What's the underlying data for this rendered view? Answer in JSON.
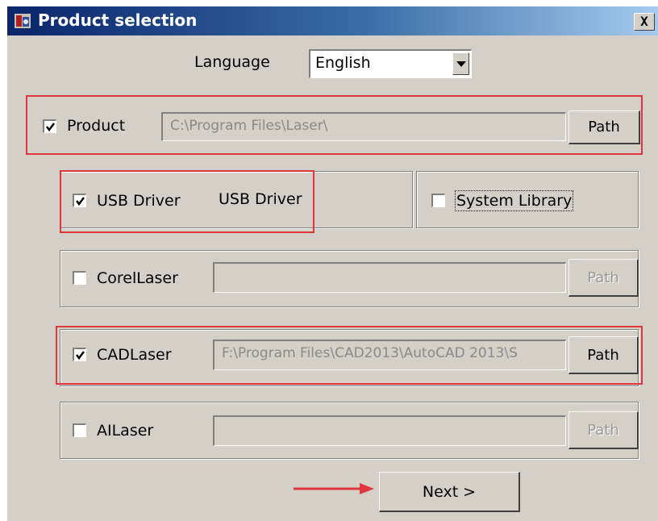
{
  "window": {
    "title": "Product selection",
    "close_label": "X"
  },
  "language": {
    "label": "Language",
    "value": "English"
  },
  "product": {
    "label": "Product",
    "checked": true,
    "path": "C:\\Program Files\\Laser\\",
    "button": "Path"
  },
  "usb_driver": {
    "label": "USB Driver",
    "checked": true,
    "status": "USB Driver"
  },
  "system_library": {
    "label": "System Library",
    "checked": false
  },
  "corel_laser": {
    "label": "CorelLaser",
    "checked": false,
    "path": "",
    "button": "Path"
  },
  "cad_laser": {
    "label": "CADLaser",
    "checked": true,
    "path": "F:\\Program Files\\CAD2013\\AutoCAD 2013\\S",
    "button": "Path"
  },
  "ai_laser": {
    "label": "AILaser",
    "checked": false,
    "path": "",
    "button": "Path"
  },
  "footer": {
    "next_label": "Next >"
  },
  "colors": {
    "dialog_bg": "#d4d0c8",
    "titlebar_start": "#0a246a",
    "titlebar_end": "#a6caf0",
    "annotation_red": "#e0353c"
  },
  "icons": {
    "app": "laser-app-icon",
    "close": "close-icon",
    "dropdown": "chevron-down-icon",
    "check": "check-icon",
    "annotation": "red-arrow-icon"
  }
}
